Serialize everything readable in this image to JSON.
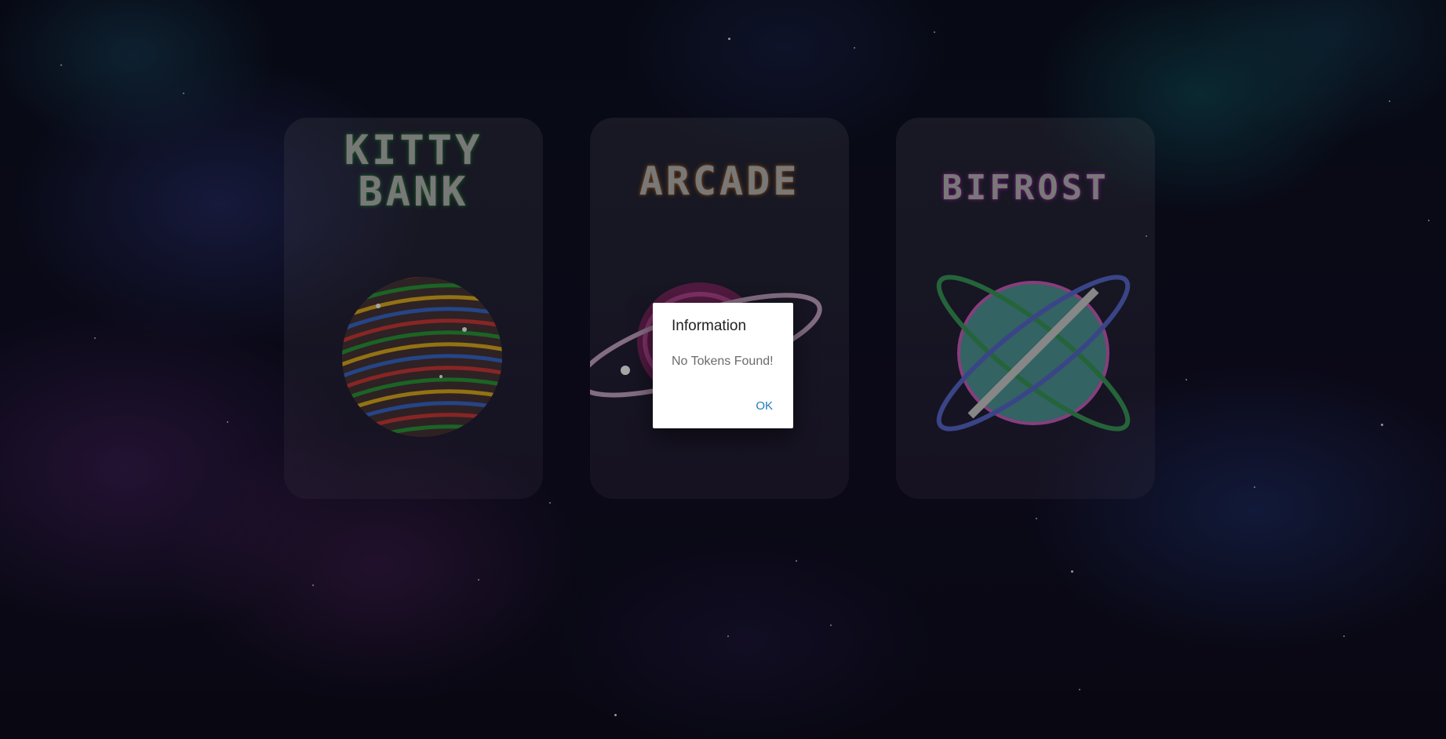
{
  "cards": [
    {
      "title_lines": [
        "KITTY",
        "BANK"
      ],
      "accent": "#2e8a3a",
      "icon": "striped-sphere-icon"
    },
    {
      "title_lines": [
        "ARCADE"
      ],
      "accent": "#b36a24",
      "icon": "ringed-planet-icon"
    },
    {
      "title_lines": [
        "BIFROST"
      ],
      "accent": "#a12aa8",
      "icon": "crossed-rings-planet-icon"
    }
  ],
  "dialog": {
    "title": "Information",
    "message": "No Tokens Found!",
    "ok_label": "OK"
  }
}
